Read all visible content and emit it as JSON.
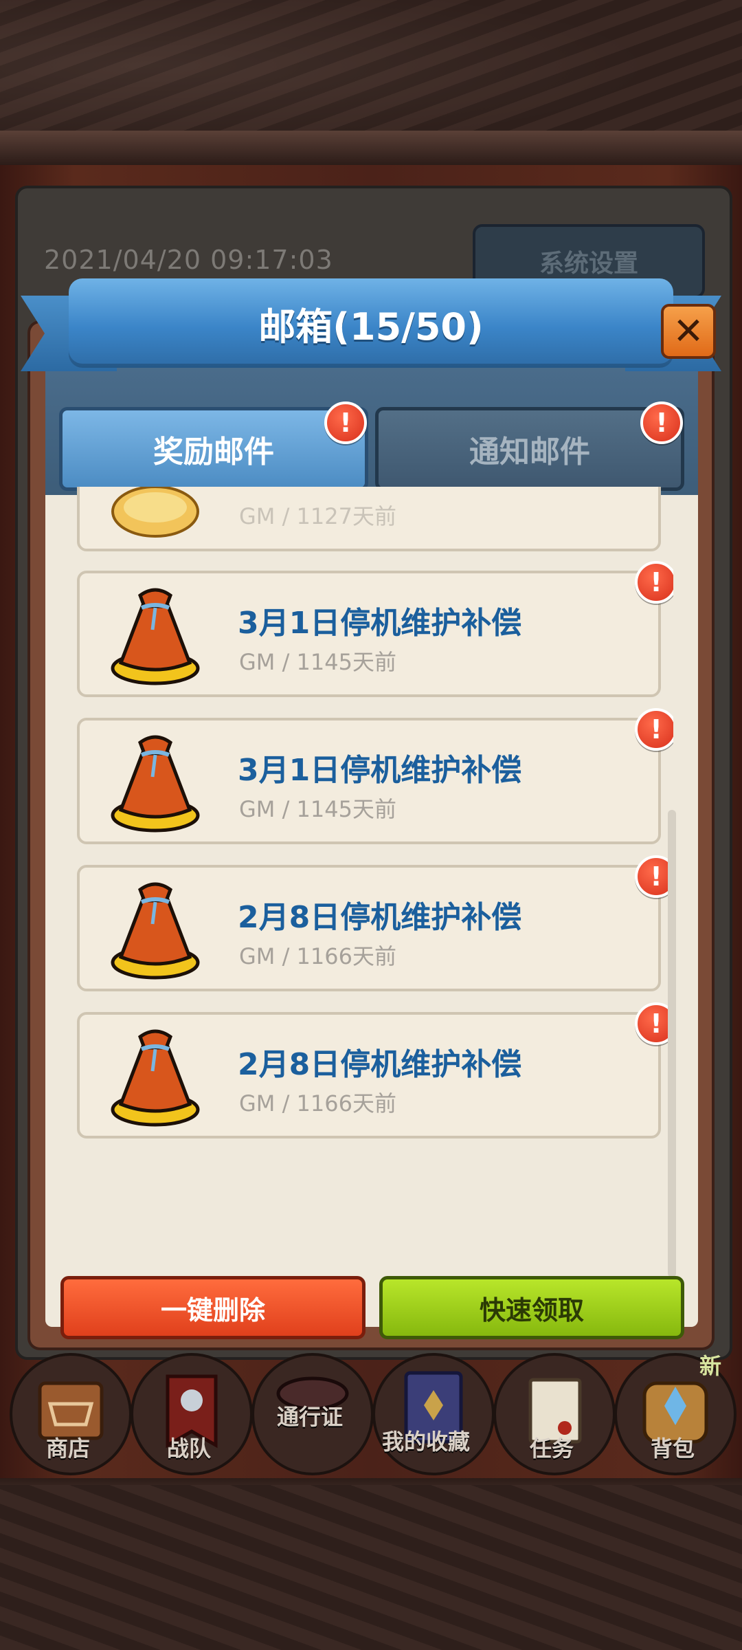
{
  "status": {
    "datetime": "2021/04/20 09:17:03"
  },
  "system_settings_label": "系统设置",
  "mailbox": {
    "title": "邮箱(15/50)",
    "close_icon": "close-icon",
    "tabs": [
      {
        "label": "奖励邮件",
        "active": true,
        "has_alert": true
      },
      {
        "label": "通知邮件",
        "active": false,
        "has_alert": true
      }
    ],
    "partial_item": {
      "meta": "GM / 1127天前"
    },
    "items": [
      {
        "title": "3月1日停机维护补偿",
        "meta": "GM / 1145天前",
        "icon": "reward-bag-icon",
        "has_alert": true
      },
      {
        "title": "3月1日停机维护补偿",
        "meta": "GM / 1145天前",
        "icon": "reward-bag-icon",
        "has_alert": true
      },
      {
        "title": "2月8日停机维护补偿",
        "meta": "GM / 1166天前",
        "icon": "reward-bag-icon",
        "has_alert": true
      },
      {
        "title": "2月8日停机维护补偿",
        "meta": "GM / 1166天前",
        "icon": "reward-bag-icon",
        "has_alert": true
      }
    ],
    "alert_symbol": "!",
    "buttons": {
      "delete_all": "一键删除",
      "quick_claim": "快速领取"
    }
  },
  "bottom_nav": [
    {
      "label": "商店",
      "icon": "shop-icon"
    },
    {
      "label": "战队",
      "icon": "team-banner-icon"
    },
    {
      "label": "通行证",
      "icon": "pass-icon"
    },
    {
      "label": "我的收藏",
      "icon": "collection-book-icon"
    },
    {
      "label": "任务",
      "icon": "quest-scroll-icon"
    },
    {
      "label": "背包",
      "icon": "backpack-icon"
    }
  ],
  "new_badge": "新",
  "colors": {
    "accent_blue": "#3b85c8",
    "title_blue": "#1b5f9d",
    "delete_red": "#e0401c",
    "claim_green": "#86b80e",
    "alert_red": "#d8301c"
  }
}
